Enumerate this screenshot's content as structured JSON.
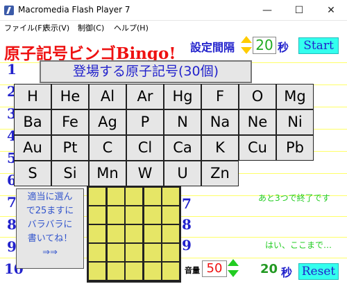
{
  "window": {
    "title": "Macromedia Flash Player 7",
    "minimize": "—",
    "maximize": "☐",
    "close": "✕"
  },
  "menu": [
    "ファイル(F)",
    "表示(V)",
    "制御(C)",
    "ヘルプ(H)"
  ],
  "game": {
    "title": "原子記号ビンゴBingo!",
    "interval_label": "設定間隔",
    "interval_value": "20",
    "interval_unit": "秒",
    "start_label": "Start",
    "header": "登場する原子記号(30個)",
    "row_numbers": [
      "1",
      "2",
      "3",
      "4",
      "5",
      "6",
      "7",
      "8",
      "9",
      "10"
    ],
    "symbols": [
      "H",
      "He",
      "Al",
      "Ar",
      "Hg",
      "F",
      "O",
      "Mg",
      "Ba",
      "Fe",
      "Ag",
      "P",
      "N",
      "Na",
      "Ne",
      "Ni",
      "Au",
      "Pt",
      "C",
      "Cl",
      "Ca",
      "K",
      "Cu",
      "Pb",
      "S",
      "Si",
      "Mn",
      "W",
      "U",
      "Zn"
    ],
    "note_lines": [
      "適当に選ん",
      "で25ますに",
      "バラバラに",
      "書いてね！",
      "⇒⇒"
    ],
    "remaining_msg": "あと3つで終了です",
    "stop_msg": "はい、ここまで…",
    "volume_label": "音量",
    "volume_value": "50",
    "timer_value": "20",
    "timer_unit": "秒",
    "reset_label": "Reset"
  },
  "colors": {
    "accent_red": "#ee1111",
    "accent_blue": "#2222cc",
    "button_cyan": "#33ffee",
    "bingo_cell": "#e6e666",
    "green_text": "#22cc22"
  }
}
